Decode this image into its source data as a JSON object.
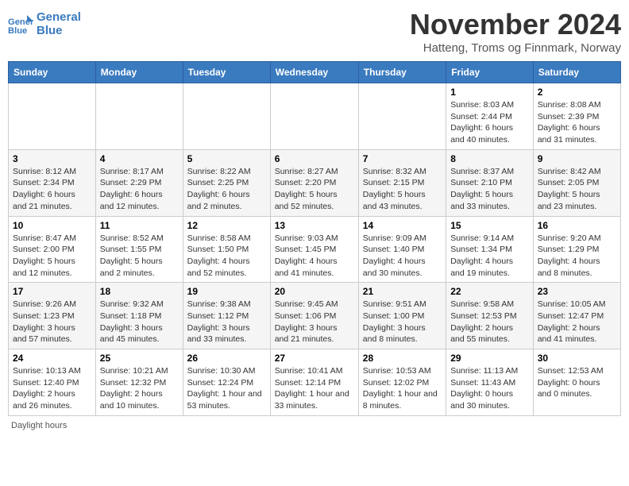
{
  "logo": {
    "line1": "General",
    "line2": "Blue",
    "icon": "🔵"
  },
  "title": "November 2024",
  "subtitle": "Hatteng, Troms og Finnmark, Norway",
  "headers": [
    "Sunday",
    "Monday",
    "Tuesday",
    "Wednesday",
    "Thursday",
    "Friday",
    "Saturday"
  ],
  "footer": "Daylight hours",
  "weeks": [
    [
      {
        "day": "",
        "info": ""
      },
      {
        "day": "",
        "info": ""
      },
      {
        "day": "",
        "info": ""
      },
      {
        "day": "",
        "info": ""
      },
      {
        "day": "",
        "info": ""
      },
      {
        "day": "1",
        "info": "Sunrise: 8:03 AM\nSunset: 2:44 PM\nDaylight: 6 hours\nand 40 minutes."
      },
      {
        "day": "2",
        "info": "Sunrise: 8:08 AM\nSunset: 2:39 PM\nDaylight: 6 hours\nand 31 minutes."
      }
    ],
    [
      {
        "day": "3",
        "info": "Sunrise: 8:12 AM\nSunset: 2:34 PM\nDaylight: 6 hours\nand 21 minutes."
      },
      {
        "day": "4",
        "info": "Sunrise: 8:17 AM\nSunset: 2:29 PM\nDaylight: 6 hours\nand 12 minutes."
      },
      {
        "day": "5",
        "info": "Sunrise: 8:22 AM\nSunset: 2:25 PM\nDaylight: 6 hours\nand 2 minutes."
      },
      {
        "day": "6",
        "info": "Sunrise: 8:27 AM\nSunset: 2:20 PM\nDaylight: 5 hours\nand 52 minutes."
      },
      {
        "day": "7",
        "info": "Sunrise: 8:32 AM\nSunset: 2:15 PM\nDaylight: 5 hours\nand 43 minutes."
      },
      {
        "day": "8",
        "info": "Sunrise: 8:37 AM\nSunset: 2:10 PM\nDaylight: 5 hours\nand 33 minutes."
      },
      {
        "day": "9",
        "info": "Sunrise: 8:42 AM\nSunset: 2:05 PM\nDaylight: 5 hours\nand 23 minutes."
      }
    ],
    [
      {
        "day": "10",
        "info": "Sunrise: 8:47 AM\nSunset: 2:00 PM\nDaylight: 5 hours\nand 12 minutes."
      },
      {
        "day": "11",
        "info": "Sunrise: 8:52 AM\nSunset: 1:55 PM\nDaylight: 5 hours\nand 2 minutes."
      },
      {
        "day": "12",
        "info": "Sunrise: 8:58 AM\nSunset: 1:50 PM\nDaylight: 4 hours\nand 52 minutes."
      },
      {
        "day": "13",
        "info": "Sunrise: 9:03 AM\nSunset: 1:45 PM\nDaylight: 4 hours\nand 41 minutes."
      },
      {
        "day": "14",
        "info": "Sunrise: 9:09 AM\nSunset: 1:40 PM\nDaylight: 4 hours\nand 30 minutes."
      },
      {
        "day": "15",
        "info": "Sunrise: 9:14 AM\nSunset: 1:34 PM\nDaylight: 4 hours\nand 19 minutes."
      },
      {
        "day": "16",
        "info": "Sunrise: 9:20 AM\nSunset: 1:29 PM\nDaylight: 4 hours\nand 8 minutes."
      }
    ],
    [
      {
        "day": "17",
        "info": "Sunrise: 9:26 AM\nSunset: 1:23 PM\nDaylight: 3 hours\nand 57 minutes."
      },
      {
        "day": "18",
        "info": "Sunrise: 9:32 AM\nSunset: 1:18 PM\nDaylight: 3 hours\nand 45 minutes."
      },
      {
        "day": "19",
        "info": "Sunrise: 9:38 AM\nSunset: 1:12 PM\nDaylight: 3 hours\nand 33 minutes."
      },
      {
        "day": "20",
        "info": "Sunrise: 9:45 AM\nSunset: 1:06 PM\nDaylight: 3 hours\nand 21 minutes."
      },
      {
        "day": "21",
        "info": "Sunrise: 9:51 AM\nSunset: 1:00 PM\nDaylight: 3 hours\nand 8 minutes."
      },
      {
        "day": "22",
        "info": "Sunrise: 9:58 AM\nSunset: 12:53 PM\nDaylight: 2 hours\nand 55 minutes."
      },
      {
        "day": "23",
        "info": "Sunrise: 10:05 AM\nSunset: 12:47 PM\nDaylight: 2 hours\nand 41 minutes."
      }
    ],
    [
      {
        "day": "24",
        "info": "Sunrise: 10:13 AM\nSunset: 12:40 PM\nDaylight: 2 hours\nand 26 minutes."
      },
      {
        "day": "25",
        "info": "Sunrise: 10:21 AM\nSunset: 12:32 PM\nDaylight: 2 hours\nand 10 minutes."
      },
      {
        "day": "26",
        "info": "Sunrise: 10:30 AM\nSunset: 12:24 PM\nDaylight: 1 hour and\n53 minutes."
      },
      {
        "day": "27",
        "info": "Sunrise: 10:41 AM\nSunset: 12:14 PM\nDaylight: 1 hour and\n33 minutes."
      },
      {
        "day": "28",
        "info": "Sunrise: 10:53 AM\nSunset: 12:02 PM\nDaylight: 1 hour and\n8 minutes."
      },
      {
        "day": "29",
        "info": "Sunrise: 11:13 AM\nSunset: 11:43 AM\nDaylight: 0 hours\nand 30 minutes."
      },
      {
        "day": "30",
        "info": "Sunset: 12:53 AM\nDaylight: 0 hours\nand 0 minutes."
      }
    ]
  ]
}
